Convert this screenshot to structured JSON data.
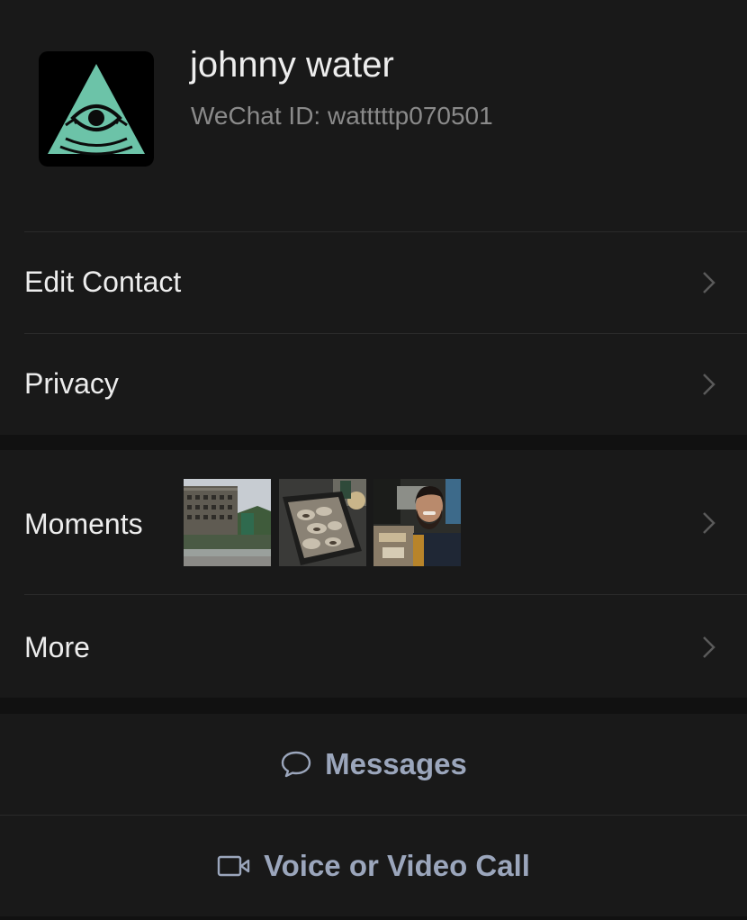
{
  "profile": {
    "name": "johnny water",
    "wechat_id_label": "WeChat ID: ",
    "wechat_id": "watttttp070501",
    "avatar_icon": "eye-pyramid-icon"
  },
  "menu": {
    "edit_contact": "Edit Contact",
    "privacy": "Privacy",
    "moments": "Moments",
    "more": "More"
  },
  "moments_thumbnails": [
    "building-fountain-photo",
    "grilled-food-photo",
    "selfie-photo"
  ],
  "actions": {
    "messages": "Messages",
    "voice_video": "Voice or Video Call"
  },
  "colors": {
    "background": "#111111",
    "row_background": "#191919",
    "accent_text": "#9ba6bc",
    "avatar_teal": "#6cc3a8"
  }
}
